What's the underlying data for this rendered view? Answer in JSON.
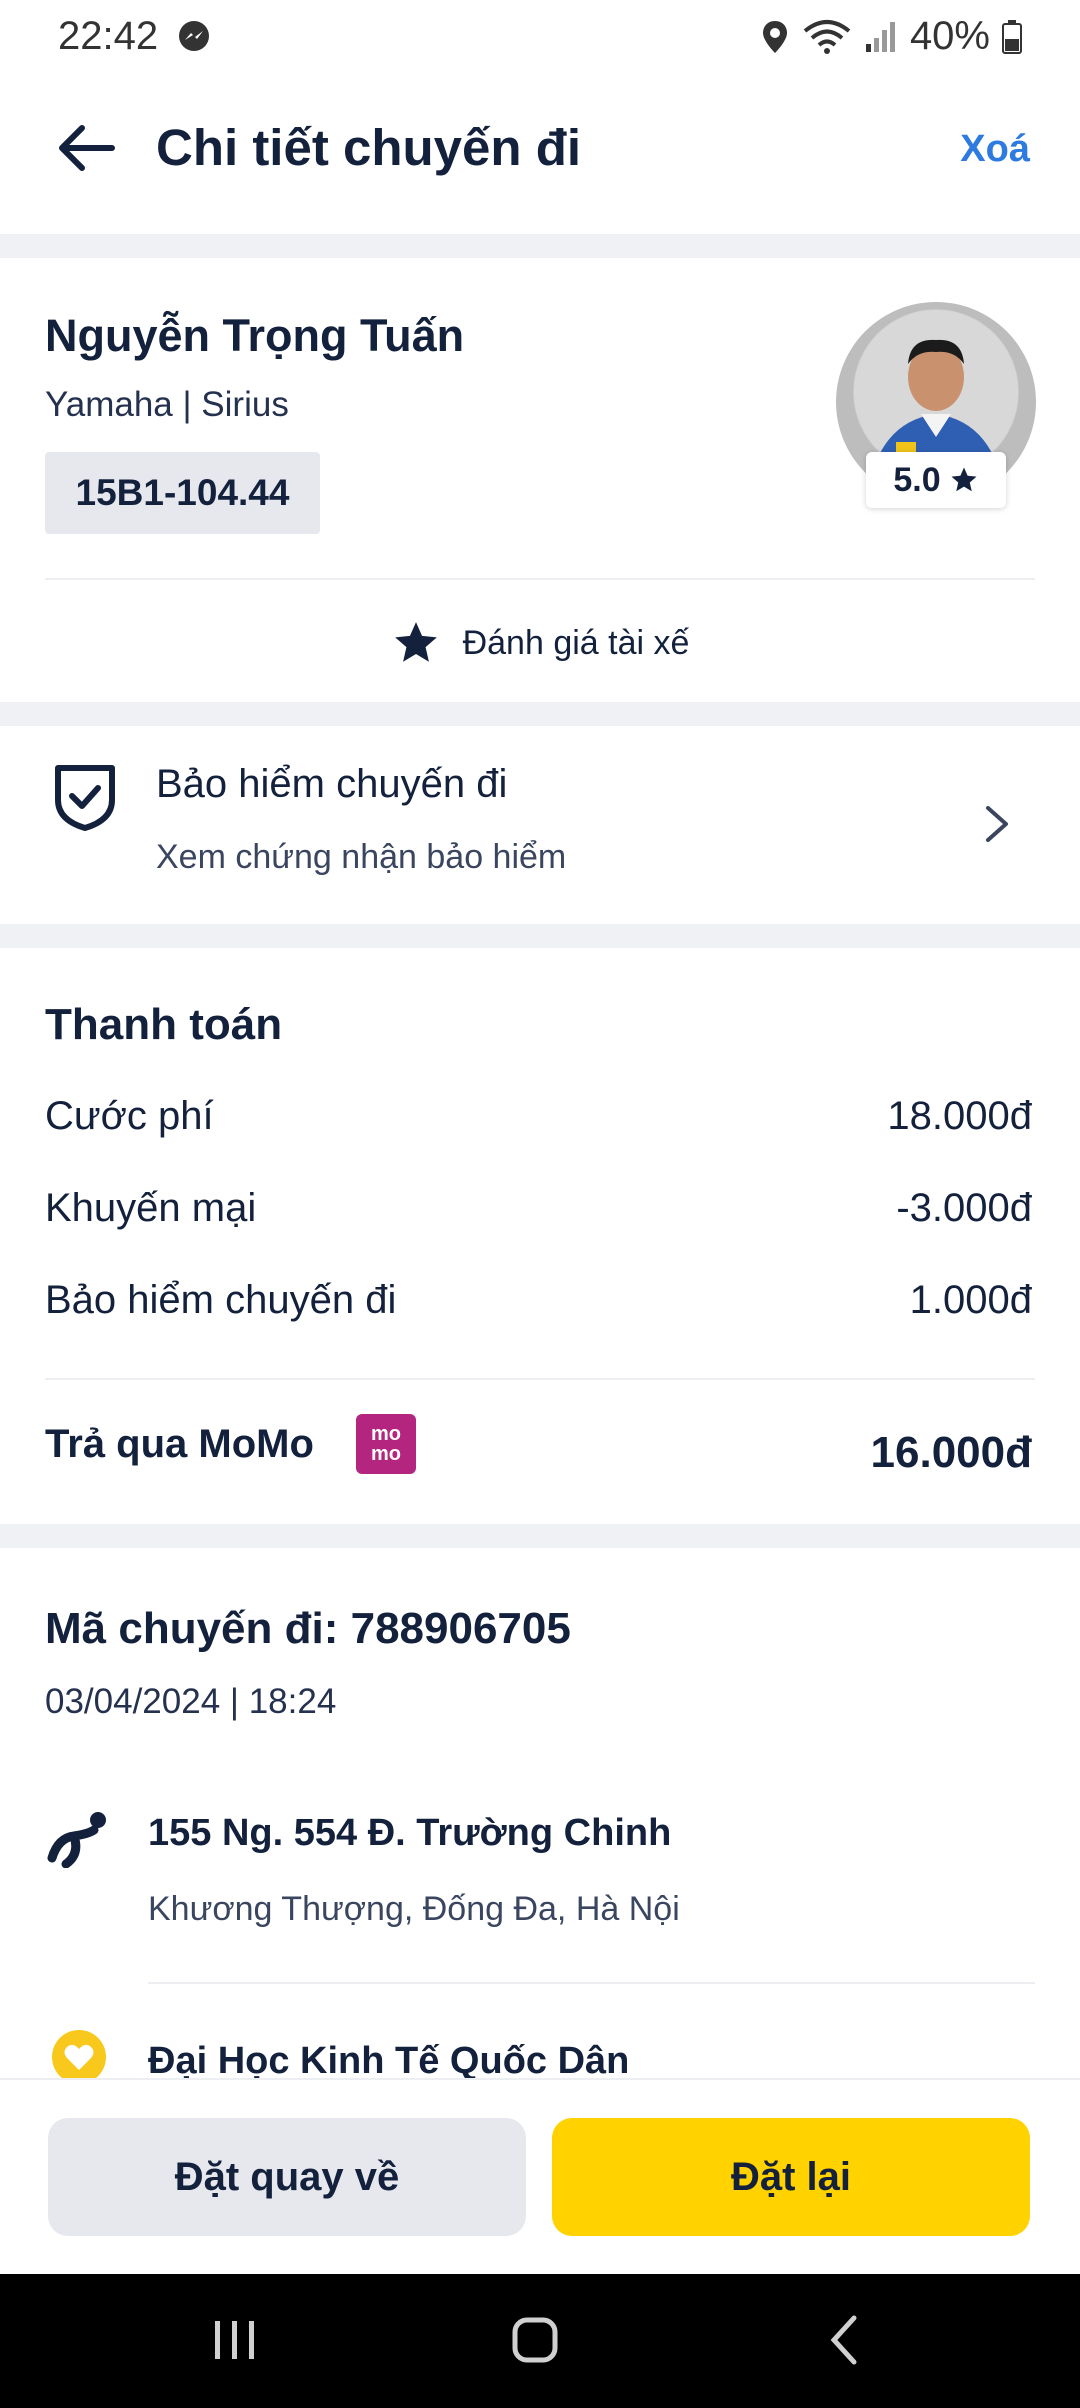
{
  "status_bar": {
    "time": "22:42",
    "battery": "40%",
    "icons": [
      "messenger-icon",
      "location-icon",
      "wifi-icon",
      "signal-icon",
      "battery-icon"
    ]
  },
  "header": {
    "title": "Chi tiết chuyến đi",
    "delete_label": "Xoá"
  },
  "driver": {
    "name": "Nguyễn Trọng Tuấn",
    "vehicle": "Yamaha | Sirius",
    "plate": "15B1-104.44",
    "rating": "5.0",
    "rate_label": "Đánh giá tài xế"
  },
  "insurance": {
    "title": "Bảo hiểm chuyến đi",
    "subtitle": "Xem chứng nhận bảo hiểm"
  },
  "payment": {
    "title": "Thanh toán",
    "rows": [
      {
        "label": "Cước phí",
        "value": "18.000đ"
      },
      {
        "label": "Khuyến mại",
        "value": "-3.000đ"
      },
      {
        "label": "Bảo hiểm chuyến đi",
        "value": "1.000đ"
      }
    ],
    "method_label": "Trả qua MoMo",
    "momo_logo_text": "mo mo",
    "total": "16.000đ"
  },
  "trip": {
    "code": "Mã chuyến đi: 788906705",
    "datetime": "03/04/2024 | 18:24",
    "pickup_title": "155 Ng. 554 Đ. Trường Chinh",
    "pickup_sub": "Khương Thượng, Đống Đa, Hà Nội",
    "dropoff_title": "Đại Học Kinh Tế Quốc Dân"
  },
  "actions": {
    "return_label": "Đặt quay về",
    "rebook_label": "Đặt lại"
  },
  "colors": {
    "primary_text": "#13213d",
    "accent_blue": "#2d7ae0",
    "rebook_yellow": "#ffd200",
    "momo_pink": "#b3257f"
  }
}
